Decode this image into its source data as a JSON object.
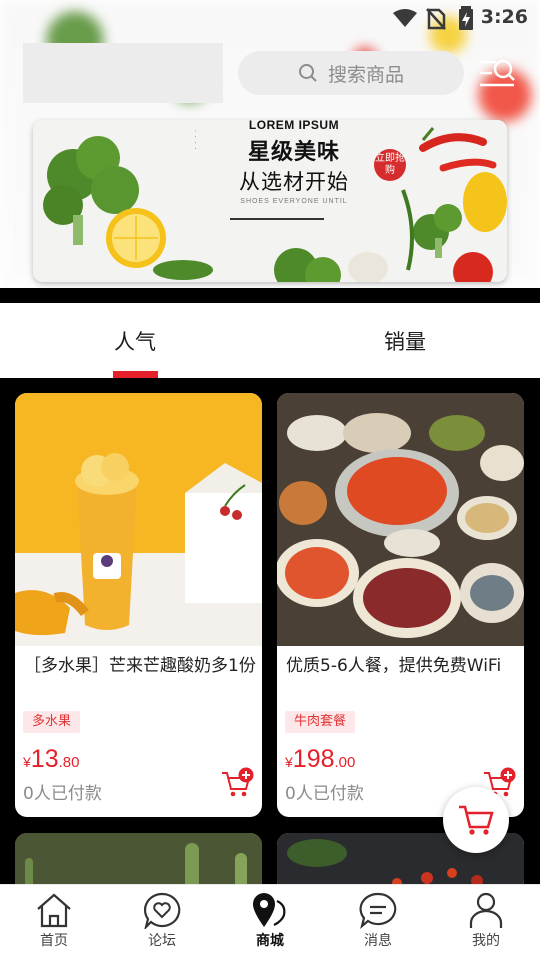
{
  "status_bar": {
    "time": "3:26"
  },
  "search": {
    "placeholder": "搜索商品"
  },
  "banner": {
    "lorem": "LOREM IPSUM",
    "title1": "星级美味",
    "title2": "从选材开始",
    "subtitle": "SHOES EVERYONE UNTIL",
    "seal": "立即抢购"
  },
  "tabs": [
    {
      "label": "人气",
      "active": true
    },
    {
      "label": "销量",
      "active": false
    }
  ],
  "products": [
    {
      "name": "［多水果］芒来芒趣酸奶多1份",
      "tag": "多水果",
      "currency": "¥",
      "price_int": "13",
      "price_dec": ".80",
      "paid": "0人已付款"
    },
    {
      "name": "优质5-6人餐，提供免费WiFi",
      "tag": "牛肉套餐",
      "currency": "¥",
      "price_int": "198",
      "price_dec": ".00",
      "paid": "0人已付款"
    }
  ],
  "bottom_nav": [
    {
      "label": "首页",
      "icon": "home-icon"
    },
    {
      "label": "论坛",
      "icon": "forum-heart-icon"
    },
    {
      "label": "商城",
      "icon": "location-pin-icon",
      "active": true
    },
    {
      "label": "消息",
      "icon": "message-icon"
    },
    {
      "label": "我的",
      "icon": "profile-icon"
    }
  ],
  "colors": {
    "accent": "#e4202a",
    "tag_bg": "#fde7e9"
  }
}
